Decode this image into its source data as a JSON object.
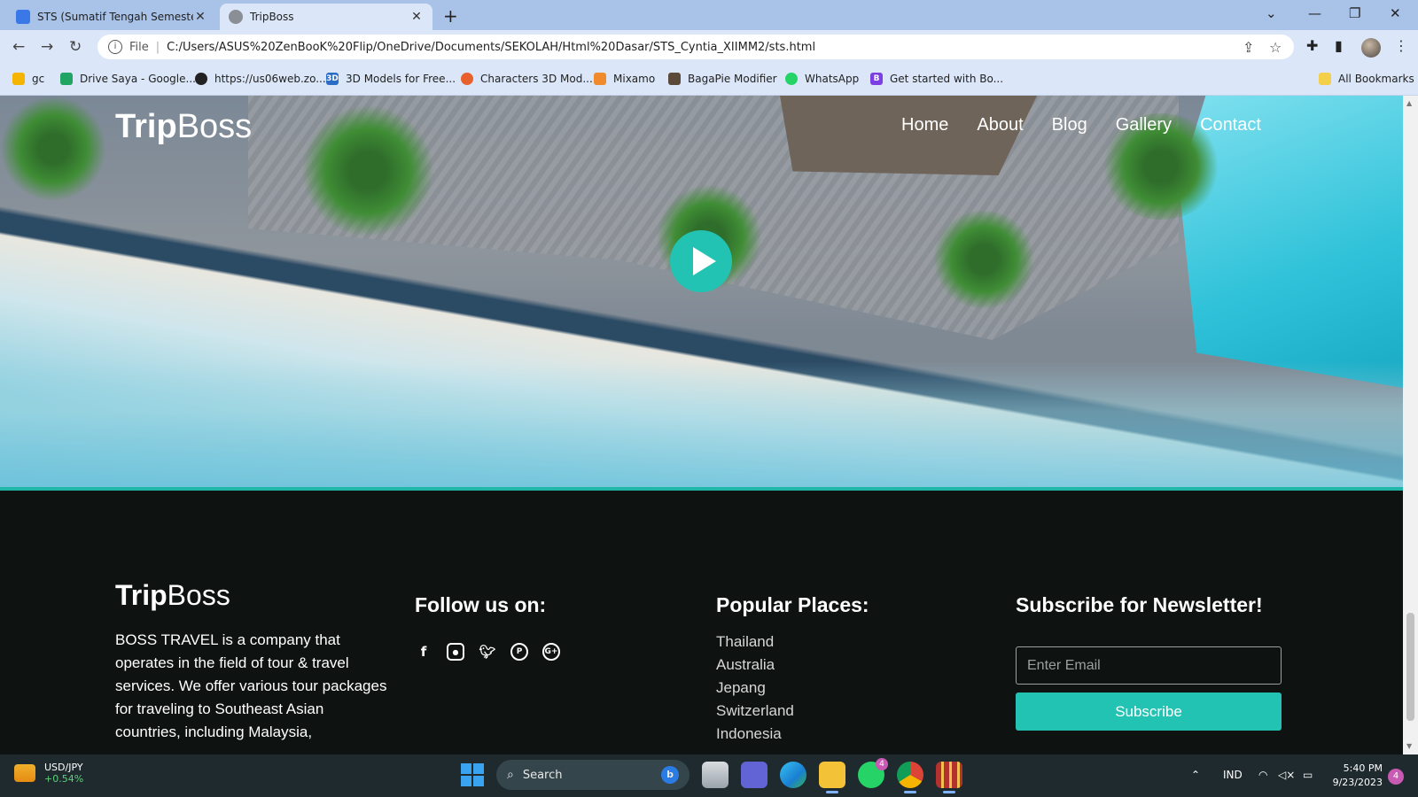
{
  "browser": {
    "tabs": [
      {
        "title": "STS (Sumatif Tengah Semester) C",
        "active": false,
        "favicon": "classroom-icon"
      },
      {
        "title": "TripBoss",
        "active": true,
        "favicon": "globe-icon"
      }
    ],
    "omnibox": {
      "scheme_label": "File",
      "url": "C:/Users/ASUS%20ZenBooK%20Flip/OneDrive/Documents/SEKOLAH/Html%20Dasar/STS_Cyntia_XIIMM2/sts.html"
    },
    "bookmarks": [
      {
        "label": "gc",
        "color": "#f5b400"
      },
      {
        "label": "Drive Saya - Google...",
        "color": "#1fa463"
      },
      {
        "label": "https://us06web.zo...",
        "color": "#222222"
      },
      {
        "label": "3D Models for Free...",
        "color": "#2b6cc4"
      },
      {
        "label": "Characters 3D Mod...",
        "color": "#e8612c"
      },
      {
        "label": "Mixamo",
        "color": "#f08a2c"
      },
      {
        "label": "BagaPie Modifier",
        "color": "#5b4a3a"
      },
      {
        "label": "WhatsApp",
        "color": "#25d366"
      },
      {
        "label": "Get started with Bo...",
        "color": "#7b3fe4"
      }
    ],
    "all_bookmarks_label": "All Bookmarks"
  },
  "site": {
    "logo_bold": "Trip",
    "logo_light": "Boss",
    "nav": [
      "Home",
      "About",
      "Blog",
      "Gallery",
      "Contact"
    ],
    "footer": {
      "about": "BOSS TRAVEL is a company that operates in the field of tour & travel services. We offer various tour packages for traveling to Southeast Asian countries, including Malaysia,",
      "follow_title": "Follow us on:",
      "social_icons": [
        "facebook-icon",
        "instagram-icon",
        "twitter-icon",
        "pinterest-icon",
        "google-plus-icon"
      ],
      "places_title": "Popular Places:",
      "places": [
        "Thailand",
        "Australia",
        "Jepang",
        "Switzerland",
        "Indonesia"
      ],
      "newsletter_title": "Subscribe for Newsletter!",
      "email_placeholder": "Enter Email",
      "subscribe_label": "Subscribe"
    },
    "accent": "#22c3b2"
  },
  "taskbar": {
    "ticker_symbol": "USD/JPY",
    "ticker_change": "+0.54%",
    "search_label": "Search",
    "whatsapp_badge": "4",
    "lang": "IND",
    "time": "5:40 PM",
    "date": "9/23/2023",
    "notifications": "4"
  }
}
